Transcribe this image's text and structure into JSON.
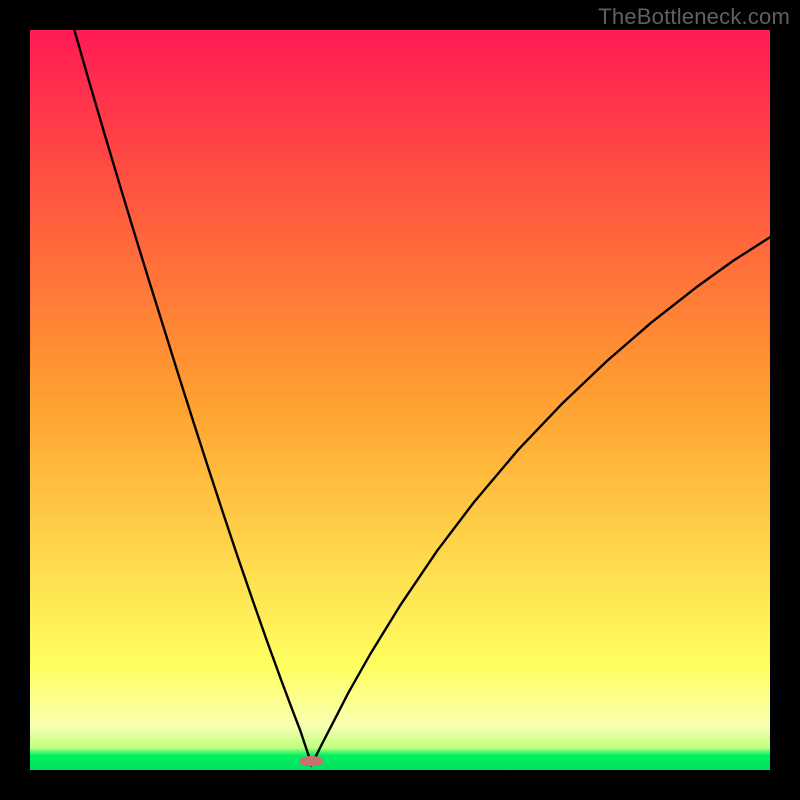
{
  "watermark": "TheBottleneck.com",
  "chart_data": {
    "type": "line",
    "title": "",
    "xlabel": "",
    "ylabel": "",
    "xlim": [
      0,
      100
    ],
    "ylim": [
      0,
      100
    ],
    "background_gradient": {
      "stops": [
        {
          "pct": 0,
          "color": "#00e060"
        },
        {
          "pct": 2,
          "color": "#00f060"
        },
        {
          "pct": 3,
          "color": "#c0ff80"
        },
        {
          "pct": 6,
          "color": "#faffb0"
        },
        {
          "pct": 14,
          "color": "#ffff60"
        },
        {
          "pct": 50,
          "color": "#ffa030"
        },
        {
          "pct": 80,
          "color": "#ff5040"
        },
        {
          "pct": 100,
          "color": "#ff1a55"
        }
      ]
    },
    "curve_color": "#000000",
    "marker": {
      "x_pct": 38,
      "y_pct": 1.2,
      "color": "#cc6f6f",
      "rx_pct": 1.6,
      "ry_pct": 0.7
    },
    "series": [
      {
        "name": "left-branch",
        "x": [
          6.0,
          8.0,
          10.0,
          12.0,
          14.0,
          16.0,
          18.0,
          20.0,
          22.0,
          24.0,
          26.0,
          28.0,
          30.0,
          32.0,
          34.0,
          35.5,
          36.5,
          37.2,
          37.7,
          38.0
        ],
        "y": [
          100.0,
          93.0,
          86.2,
          79.5,
          72.9,
          66.4,
          60.0,
          53.6,
          47.3,
          41.1,
          35.0,
          29.0,
          23.2,
          17.5,
          12.0,
          8.0,
          5.4,
          3.3,
          1.8,
          0.6
        ]
      },
      {
        "name": "right-branch",
        "x": [
          38.0,
          38.6,
          39.5,
          41.0,
          43.0,
          46.0,
          50.0,
          55.0,
          60.0,
          66.0,
          72.0,
          78.0,
          84.0,
          90.0,
          95.0,
          100.0
        ],
        "y": [
          0.6,
          1.8,
          3.6,
          6.5,
          10.4,
          15.7,
          22.2,
          29.6,
          36.2,
          43.3,
          49.6,
          55.3,
          60.5,
          65.2,
          68.8,
          72.0
        ]
      }
    ]
  }
}
